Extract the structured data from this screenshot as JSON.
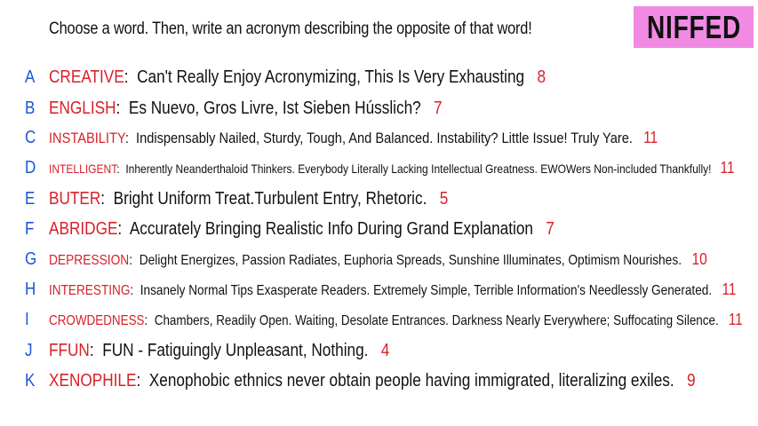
{
  "header": {
    "prompt": "Choose a word. Then, write an acronym describing the opposite of that word!",
    "logo": "NIFFED"
  },
  "colors": {
    "letter": "#1a56d6",
    "word": "#d8202a",
    "number": "#d8202a",
    "logo_bg": "#f08ae3"
  },
  "entries": [
    {
      "letter": "A",
      "word": "CREATIVE",
      "acronym": "Can't Really Enjoy Acronymizing, This Is Very Exhausting",
      "score": "8"
    },
    {
      "letter": "B",
      "word": "ENGLISH",
      "acronym": "Es Nuevo, Gros Livre, Ist Sieben Hússlich?",
      "score": "7"
    },
    {
      "letter": "C",
      "word": "INSTABILITY",
      "acronym": "Indispensably Nailed, Sturdy, Tough, And Balanced. Instability? Little Issue! Truly Yare.",
      "score": "11"
    },
    {
      "letter": "D",
      "word": "INTELLIGENT",
      "acronym": "Inherently Neanderthaloid Thinkers. Everybody Literally Lacking Intellectual Greatness. EWOWers Non-included Thankfully!",
      "score": "11"
    },
    {
      "letter": "E",
      "word": "BUTER",
      "acronym": "Bright Uniform Treat.Turbulent Entry, Rhetoric.",
      "score": "5"
    },
    {
      "letter": "F",
      "word": "ABRIDGE",
      "acronym": "Accurately Bringing Realistic Info During Grand Explanation",
      "score": "7"
    },
    {
      "letter": "G",
      "word": "DEPRESSION",
      "acronym": "Delight Energizes, Passion Radiates, Euphoria Spreads, Sunshine Illuminates, Optimism Nourishes.",
      "score": "10"
    },
    {
      "letter": "H",
      "word": "INTERESTING",
      "acronym": "Insanely Normal Tips Exasperate Readers. Extremely Simple, Terrible Information's Needlessly Generated.",
      "score": "11"
    },
    {
      "letter": "I",
      "word": "CROWDEDNESS",
      "acronym": "Chambers, Readily Open. Waiting, Desolate Entrances. Darkness Nearly Everywhere; Suffocating Silence.",
      "score": "11"
    },
    {
      "letter": "J",
      "word": "FFUN",
      "acronym": "FUN - Fatiguingly Unpleasant, Nothing.",
      "score": "4"
    },
    {
      "letter": "K",
      "word": "XENOPHILE",
      "acronym": "Xenophobic ethnics never obtain people having immigrated, literalizing exiles.",
      "score": "9"
    }
  ]
}
